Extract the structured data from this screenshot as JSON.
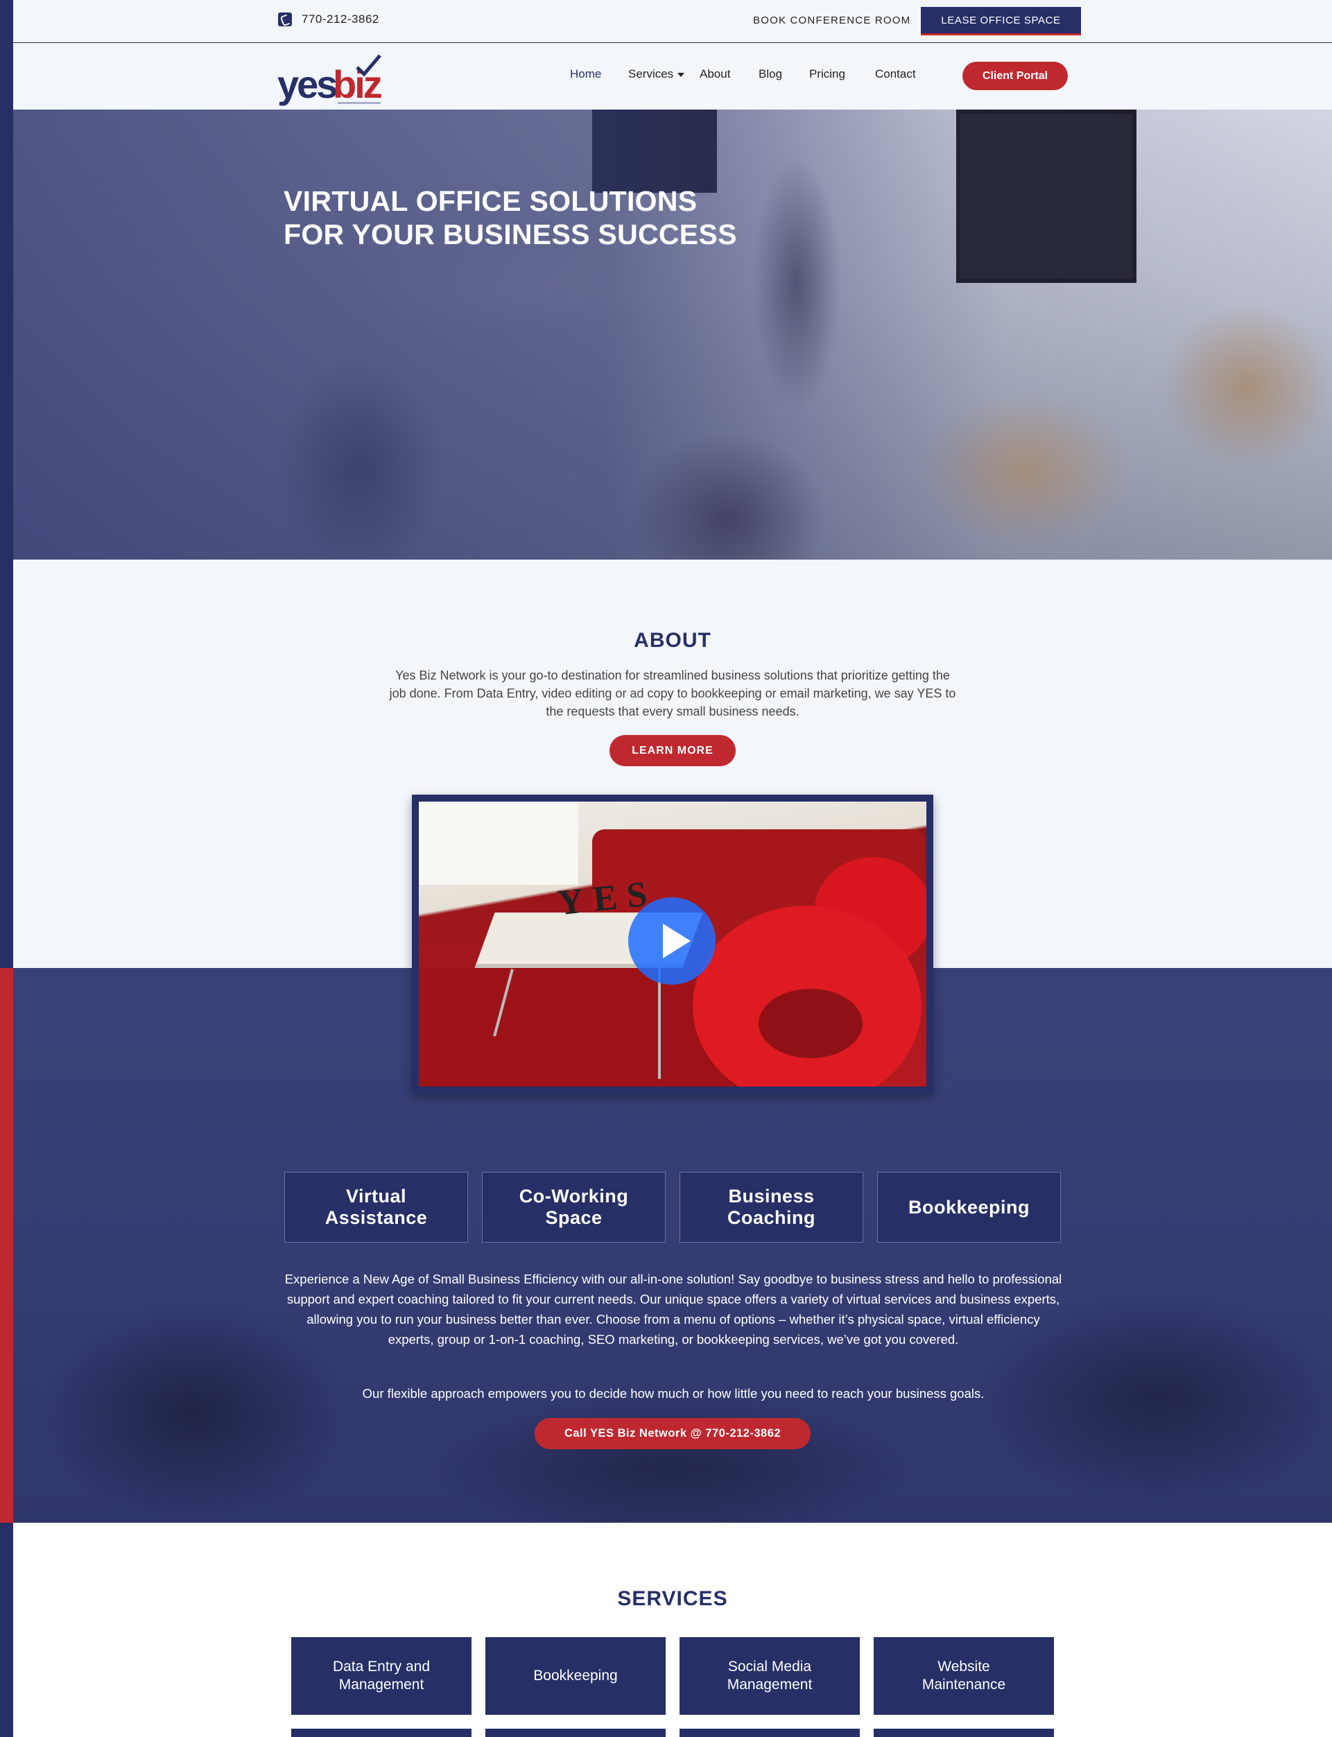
{
  "topbar": {
    "phone": "770-212-3862",
    "book_link": "BOOK CONFERENCE ROOM",
    "lease_button": "LEASE OFFICE SPACE"
  },
  "brand": {
    "logo_part1": "yes",
    "logo_part2": "biz",
    "primary_color": "#262f66",
    "accent_color": "#c0282f"
  },
  "nav": {
    "home": "Home",
    "services": "Services",
    "about": "About",
    "blog": "Blog",
    "pricing": "Pricing",
    "contact": "Contact",
    "portal_button": "Client Portal"
  },
  "hero": {
    "title_line1": "VIRTUAL OFFICE SOLUTIONS",
    "title_line2": "FOR YOUR BUSINESS SUCCESS"
  },
  "about": {
    "title": "ABOUT",
    "text": "Yes Biz Network is your go-to destination for streamlined business solutions that prioritize getting the job done. From Data Entry, video editing or ad copy to bookkeeping or email marketing, we say YES to the requests that every small business needs.",
    "button": "LEARN MORE",
    "video_letters": "YES"
  },
  "offerings": {
    "tabs": [
      {
        "label_line1": "Virtual",
        "label_line2": "Assistance"
      },
      {
        "label_line1": "Co-Working",
        "label_line2": "Space"
      },
      {
        "label_line1": "Business",
        "label_line2": "Coaching"
      },
      {
        "label_line1": "Bookkeeping",
        "label_line2": ""
      }
    ],
    "paragraph1": "Experience a New Age of Small Business Efficiency with our all-in-one solution! Say goodbye to business stress and hello to professional support and expert coaching tailored to fit your current needs. Our unique space offers a variety of virtual services and business experts, allowing you to run your business better than ever. Choose from a menu of options – whether it’s physical space, virtual efficiency experts, group or 1-on-1 coaching, SEO marketing, or bookkeeping services, we’ve got you covered.",
    "paragraph2": "Our flexible approach empowers you to decide how much or how little you need to reach your business goals.",
    "call_button": "Call YES Biz Network @ 770-212-3862"
  },
  "services": {
    "title": "SERVICES",
    "items": [
      {
        "line1": "Data Entry and",
        "line2": "Management"
      },
      {
        "line1": "Bookkeeping",
        "line2": ""
      },
      {
        "line1": "Social Media",
        "line2": "Management"
      },
      {
        "line1": "Website",
        "line2": "Maintenance"
      }
    ]
  }
}
